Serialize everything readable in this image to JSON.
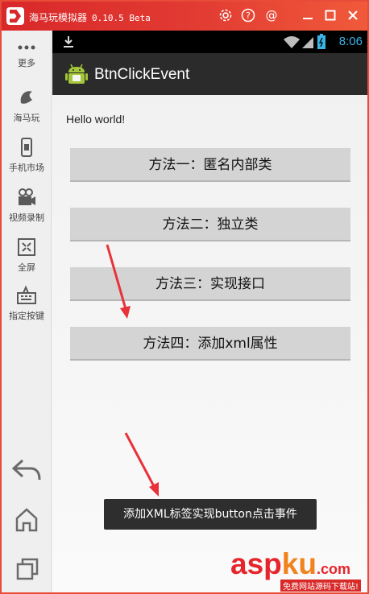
{
  "window": {
    "title": "海马玩模拟器",
    "version": "0.10.5 Beta",
    "controls": [
      "settings-icon",
      "help-icon",
      "account-icon",
      "minimize-icon",
      "maximize-icon",
      "close-icon"
    ]
  },
  "sidebar": {
    "items": [
      {
        "label": "更多",
        "icon": "more-dots-icon"
      },
      {
        "label": "海马玩",
        "icon": "haima-logo-icon"
      },
      {
        "label": "手机市场",
        "icon": "phone-market-icon"
      },
      {
        "label": "视频录制",
        "icon": "video-record-icon"
      },
      {
        "label": "全屏",
        "icon": "fullscreen-icon"
      },
      {
        "label": "指定按键",
        "icon": "keymap-icon"
      }
    ],
    "nav_icons": [
      "back-icon",
      "home-icon",
      "recent-apps-icon"
    ]
  },
  "status_bar": {
    "time": "8:06",
    "icons": [
      "download-icon",
      "wifi-icon",
      "signal-icon",
      "battery-icon"
    ],
    "accent": "#3bb4e8"
  },
  "action_bar": {
    "app_title": "BtnClickEvent",
    "icon": "android-icon"
  },
  "content": {
    "hello_text": "Hello world!",
    "buttons": [
      "方法一：匿名内部类",
      "方法二：独立类",
      "方法三：实现接口",
      "方法四：添加xml属性"
    ],
    "toast": "添加XML标签实现button点击事件"
  },
  "watermark": {
    "text_a": "asp",
    "text_b": "ku",
    "text_c": ".com",
    "sub": "免费网站源码下载站!"
  },
  "colors": {
    "titlebar": "#e23c33",
    "annotation_arrow": "#e8323a",
    "button": "#d4d4d4",
    "action_bar": "#2b2b2b"
  }
}
